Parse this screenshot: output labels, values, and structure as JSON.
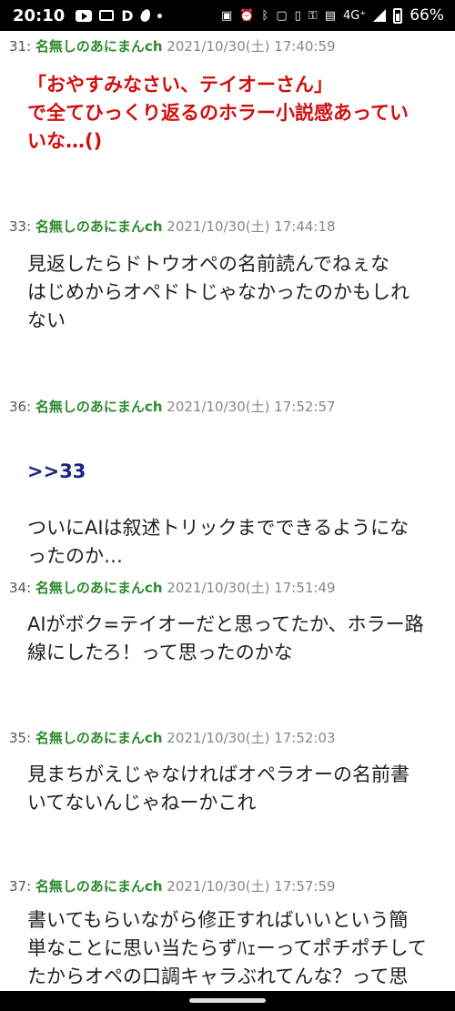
{
  "status": {
    "time": "20:10",
    "battery_pct": "66%",
    "network": "4G⁺"
  },
  "posts": [
    {
      "num": "31:",
      "name": "名無しのあにまんch",
      "date": "2021/10/30(土) 17:40:59",
      "body": "「おやすみなさい、テイオーさん」\nで全てひっくり返るのホラー小説感あってい\nいな…()",
      "anchor": ""
    },
    {
      "num": "33:",
      "name": "名無しのあにまんch",
      "date": "2021/10/30(土) 17:44:18",
      "body": "見返したらドトウオペの名前読んでねぇな\nはじめからオペドトじゃなかったのかもしれ\nない",
      "anchor": ""
    },
    {
      "num": "36:",
      "name": "名無しのあにまんch",
      "date": "2021/10/30(土) 17:52:57",
      "body": "ついにAIは叙述トリックまでできるようにな\nったのか…",
      "anchor": ">>33"
    },
    {
      "num": "34:",
      "name": "名無しのあにまんch",
      "date": "2021/10/30(土) 17:51:49",
      "body": "AIがボク=テイオーだと思ってたか、ホラー路\n線にしたろ！って思ったのかな",
      "anchor": ""
    },
    {
      "num": "35:",
      "name": "名無しのあにまんch",
      "date": "2021/10/30(土) 17:52:03",
      "body": "見まちがえじゃなければオペラオーの名前書\nいてないんじゃねーかこれ",
      "anchor": ""
    },
    {
      "num": "37:",
      "name": "名無しのあにまんch",
      "date": "2021/10/30(土) 17:57:59",
      "body": "書いてもらいながら修正すればいいという簡\n単なことに思い当たらずﾊｪーってポチポチして\nたからオペの口調キャラぶれてんな？って思",
      "anchor": ""
    }
  ],
  "colors": {
    "name_green": "#2e8b2e",
    "highlight_red": "#d01010",
    "anchor_navy": "#1a237e"
  }
}
